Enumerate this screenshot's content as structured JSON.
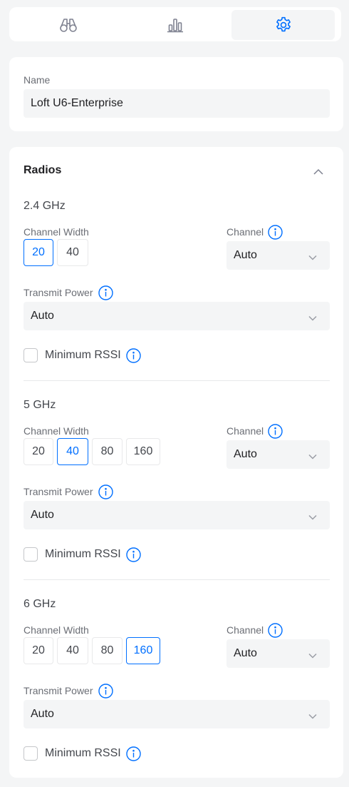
{
  "tabs": [
    {
      "icon": "binoculars-icon"
    },
    {
      "icon": "bar-chart-icon"
    },
    {
      "icon": "gear-icon",
      "active": true
    }
  ],
  "name": {
    "label": "Name",
    "value": "Loft U6-Enterprise"
  },
  "radios": {
    "title": "Radios",
    "bands": [
      {
        "title": "2.4 GHz",
        "channel_width_label": "Channel Width",
        "widths": [
          "20",
          "40"
        ],
        "selected_width": "20",
        "channel_label": "Channel",
        "channel_value": "Auto",
        "transmit_power_label": "Transmit Power",
        "transmit_power_value": "Auto",
        "min_rssi_label": "Minimum RSSI",
        "min_rssi_checked": false
      },
      {
        "title": "5 GHz",
        "channel_width_label": "Channel Width",
        "widths": [
          "20",
          "40",
          "80",
          "160"
        ],
        "selected_width": "40",
        "channel_label": "Channel",
        "channel_value": "Auto",
        "transmit_power_label": "Transmit Power",
        "transmit_power_value": "Auto",
        "min_rssi_label": "Minimum RSSI",
        "min_rssi_checked": false
      },
      {
        "title": "6 GHz",
        "channel_width_label": "Channel Width",
        "widths": [
          "20",
          "40",
          "80",
          "160"
        ],
        "selected_width": "160",
        "channel_label": "Channel",
        "channel_value": "Auto",
        "transmit_power_label": "Transmit Power",
        "transmit_power_value": "Auto",
        "min_rssi_label": "Minimum RSSI",
        "min_rssi_checked": false
      }
    ]
  },
  "colors": {
    "accent": "#006fff",
    "icon": "#7e8190",
    "background": "#f4f5f6"
  }
}
